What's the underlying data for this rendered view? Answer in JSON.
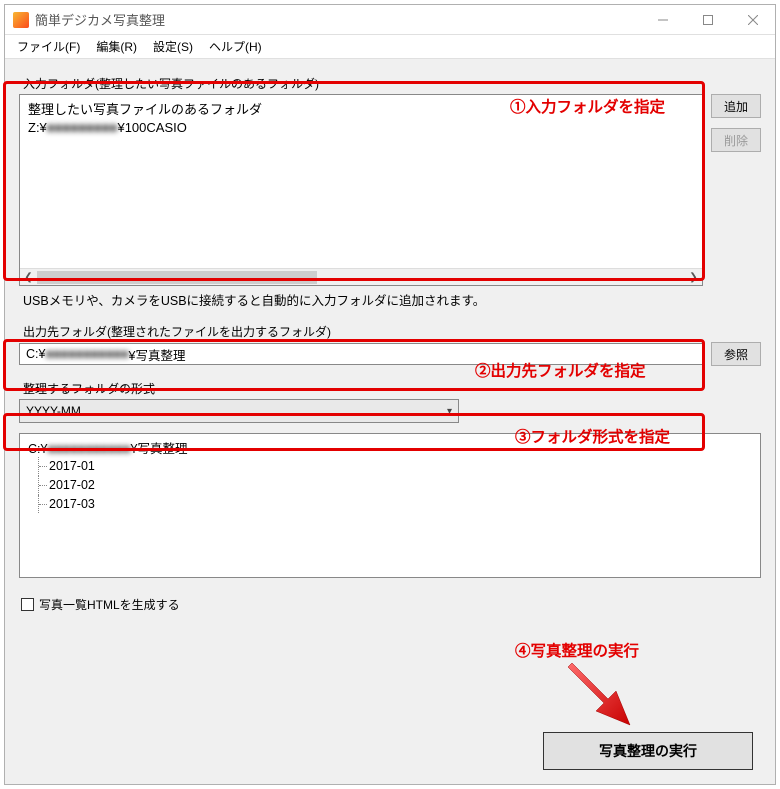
{
  "title": "簡単デジカメ写真整理",
  "window_controls": {
    "min": "minimize",
    "max": "maximize",
    "close": "close"
  },
  "menu": {
    "file": "ファイル(F)",
    "edit": "編集(R)",
    "settings": "設定(S)",
    "help": "ヘルプ(H)"
  },
  "input_folder": {
    "label": "入力フォルダ(整理したい写真ファイルのあるフォルダ)",
    "header": "整理したい写真ファイルのあるフォルダ",
    "row_prefix": "Z:¥",
    "row_mid_blurred": "■■■■■■■■■",
    "row_suffix": "¥100CASIO",
    "add_btn": "追加",
    "del_btn": "削除",
    "hint": "USBメモリや、カメラをUSBに接続すると自動的に入力フォルダに追加されます。"
  },
  "output": {
    "label": "出力先フォルダ(整理されたファイルを出力するフォルダ)",
    "val_prefix": "C:¥",
    "val_mid_blurred": "■■■■■■■■■■■",
    "val_suffix": "¥写真整理",
    "browse_btn": "参照"
  },
  "format": {
    "label": "整理するフォルダの形式",
    "value": "YYYY-MM"
  },
  "tree": {
    "root_prefix": "C:¥",
    "root_mid_blurred": "■■■■■■■■■■■",
    "root_suffix": "¥写真整理",
    "children": [
      "2017-01",
      "2017-02",
      "2017-03"
    ]
  },
  "checkbox": {
    "label": "写真一覧HTMLを生成する"
  },
  "run_btn": "写真整理の実行",
  "annotations": {
    "a1": "①入力フォルダを指定",
    "a2": "②出力先フォルダを指定",
    "a3": "③フォルダ形式を指定",
    "a4": "④写真整理の実行"
  }
}
